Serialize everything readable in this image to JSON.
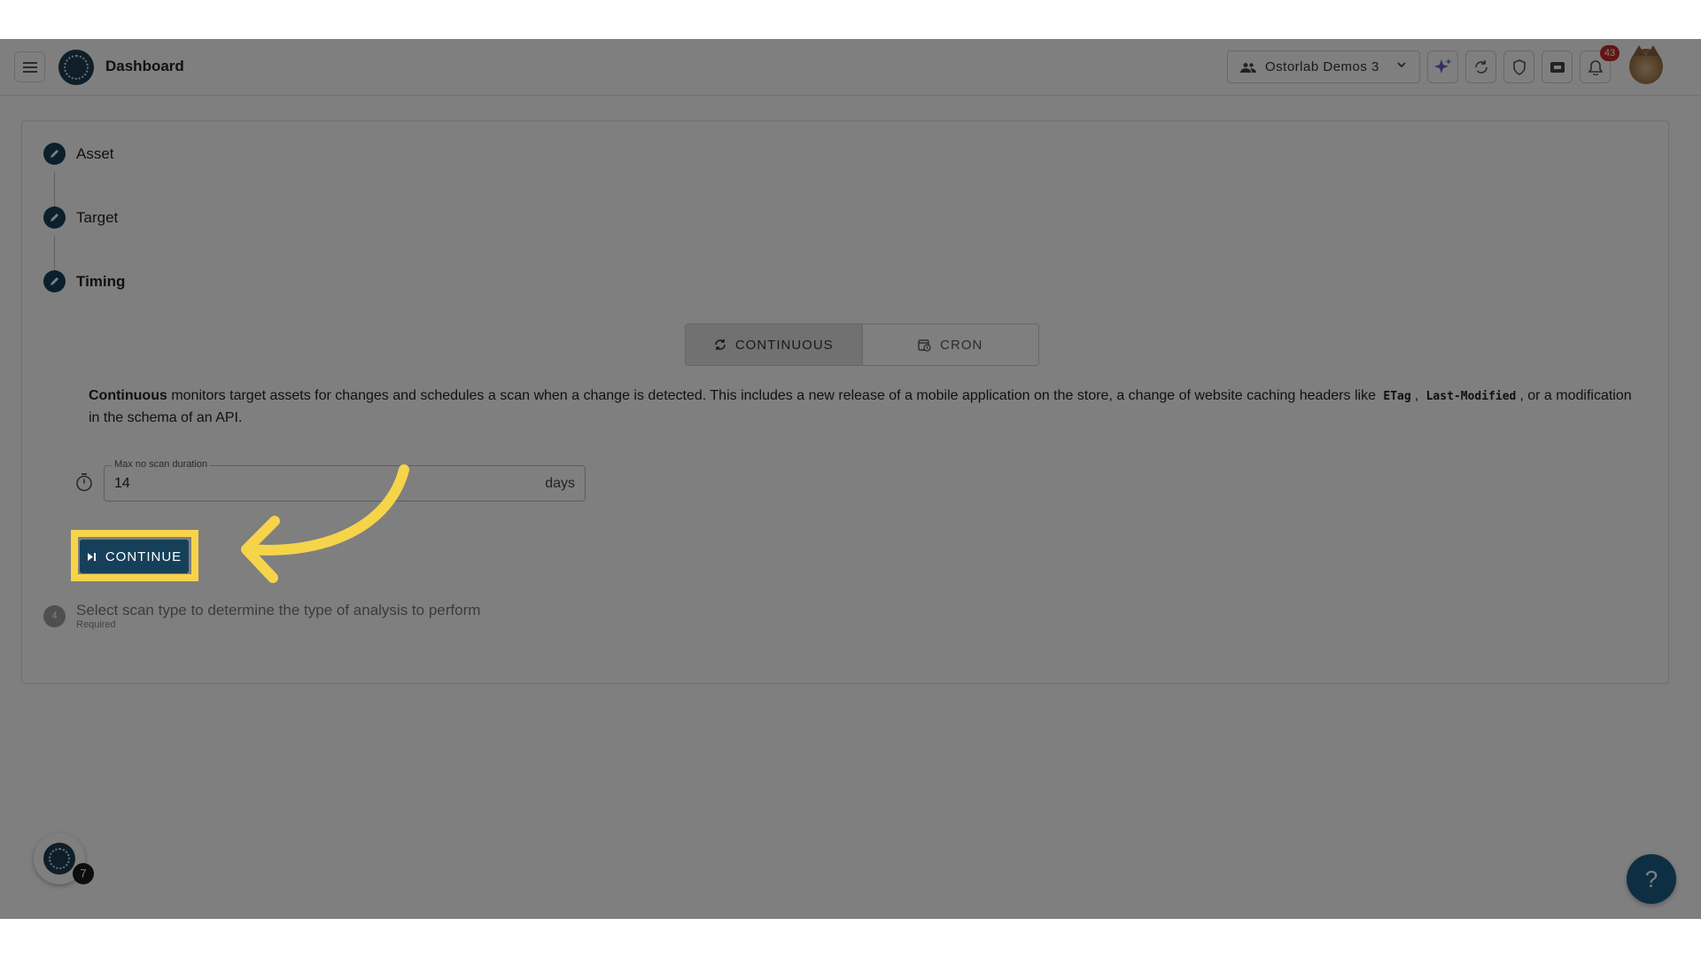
{
  "header": {
    "title": "Dashboard",
    "org_name": "Ostorlab Demos 3",
    "notification_count": "43"
  },
  "steps": [
    {
      "label": "Asset"
    },
    {
      "label": "Target"
    },
    {
      "label": "Timing"
    }
  ],
  "timing": {
    "modes": [
      {
        "label": "CONTINUOUS",
        "selected": true
      },
      {
        "label": "CRON",
        "selected": false
      }
    ],
    "description": {
      "lead": "Continuous",
      "text_before": " monitors target assets for changes and schedules a scan when a change is detected. This includes a new release of a mobile application on the store, a change of website caching headers like ",
      "code1": "ETag",
      "sep": ", ",
      "code2": "Last-Modified",
      "text_after": ", or a modification in the schema of an API."
    },
    "max_duration": {
      "label": "Max no scan duration",
      "value": "14",
      "unit": "days"
    },
    "continue_label": "CONTINUE"
  },
  "step4": {
    "number": "4",
    "title": "Select scan type to determine the type of analysis to perform",
    "sub": "Required"
  },
  "floating": {
    "count": "7",
    "help": "?"
  },
  "colors": {
    "primary": "#16405a",
    "highlight": "#f6d44a",
    "badge": "#c62828",
    "help": "#1d5f86"
  }
}
